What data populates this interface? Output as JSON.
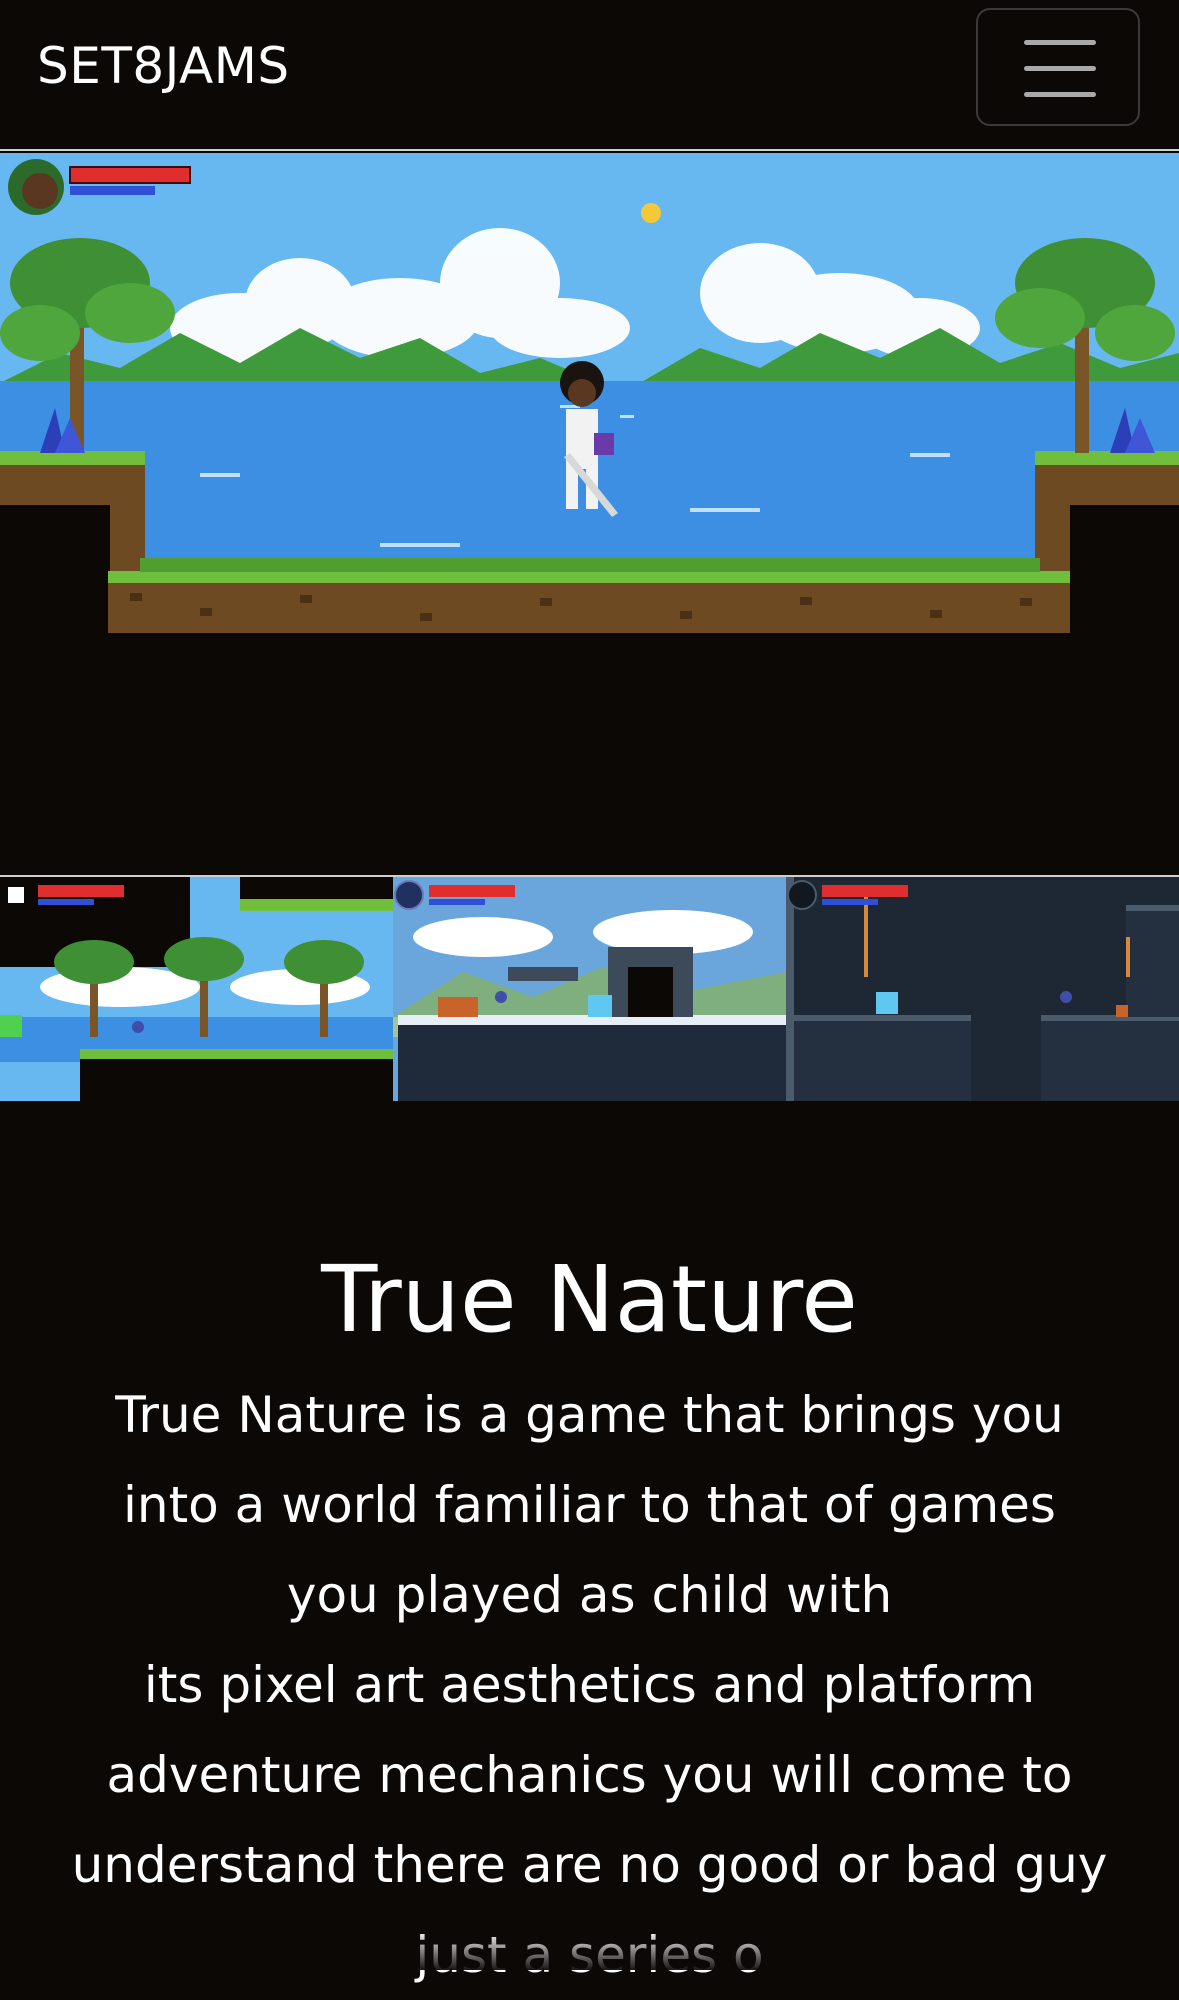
{
  "navbar": {
    "brand": "SET8JAMS",
    "menu_icon": "hamburger-menu-icon"
  },
  "hero": {
    "image_name": "true-nature-hero-screenshot"
  },
  "thumbnails": [
    {
      "name": "forest-level-thumbnail"
    },
    {
      "name": "snow-level-thumbnail"
    },
    {
      "name": "cave-level-thumbnail"
    }
  ],
  "game": {
    "title": "True Nature",
    "description_lines": [
      "True Nature is a game that brings you",
      "into a world familiar to that of games",
      "you played as child with",
      "its pixel art aesthetics and platform",
      "adventure mechanics you will come to",
      "understand there are no good or bad guy",
      "just a series o"
    ]
  },
  "colors": {
    "background": "#0b0806",
    "text": "#ffffff",
    "sky": "#67b7f0",
    "water": "#3d8fe3",
    "grass": "#6fbf3c",
    "dirt": "#6e4a22",
    "health": "#e02d2d",
    "mana": "#2f4fd6"
  }
}
